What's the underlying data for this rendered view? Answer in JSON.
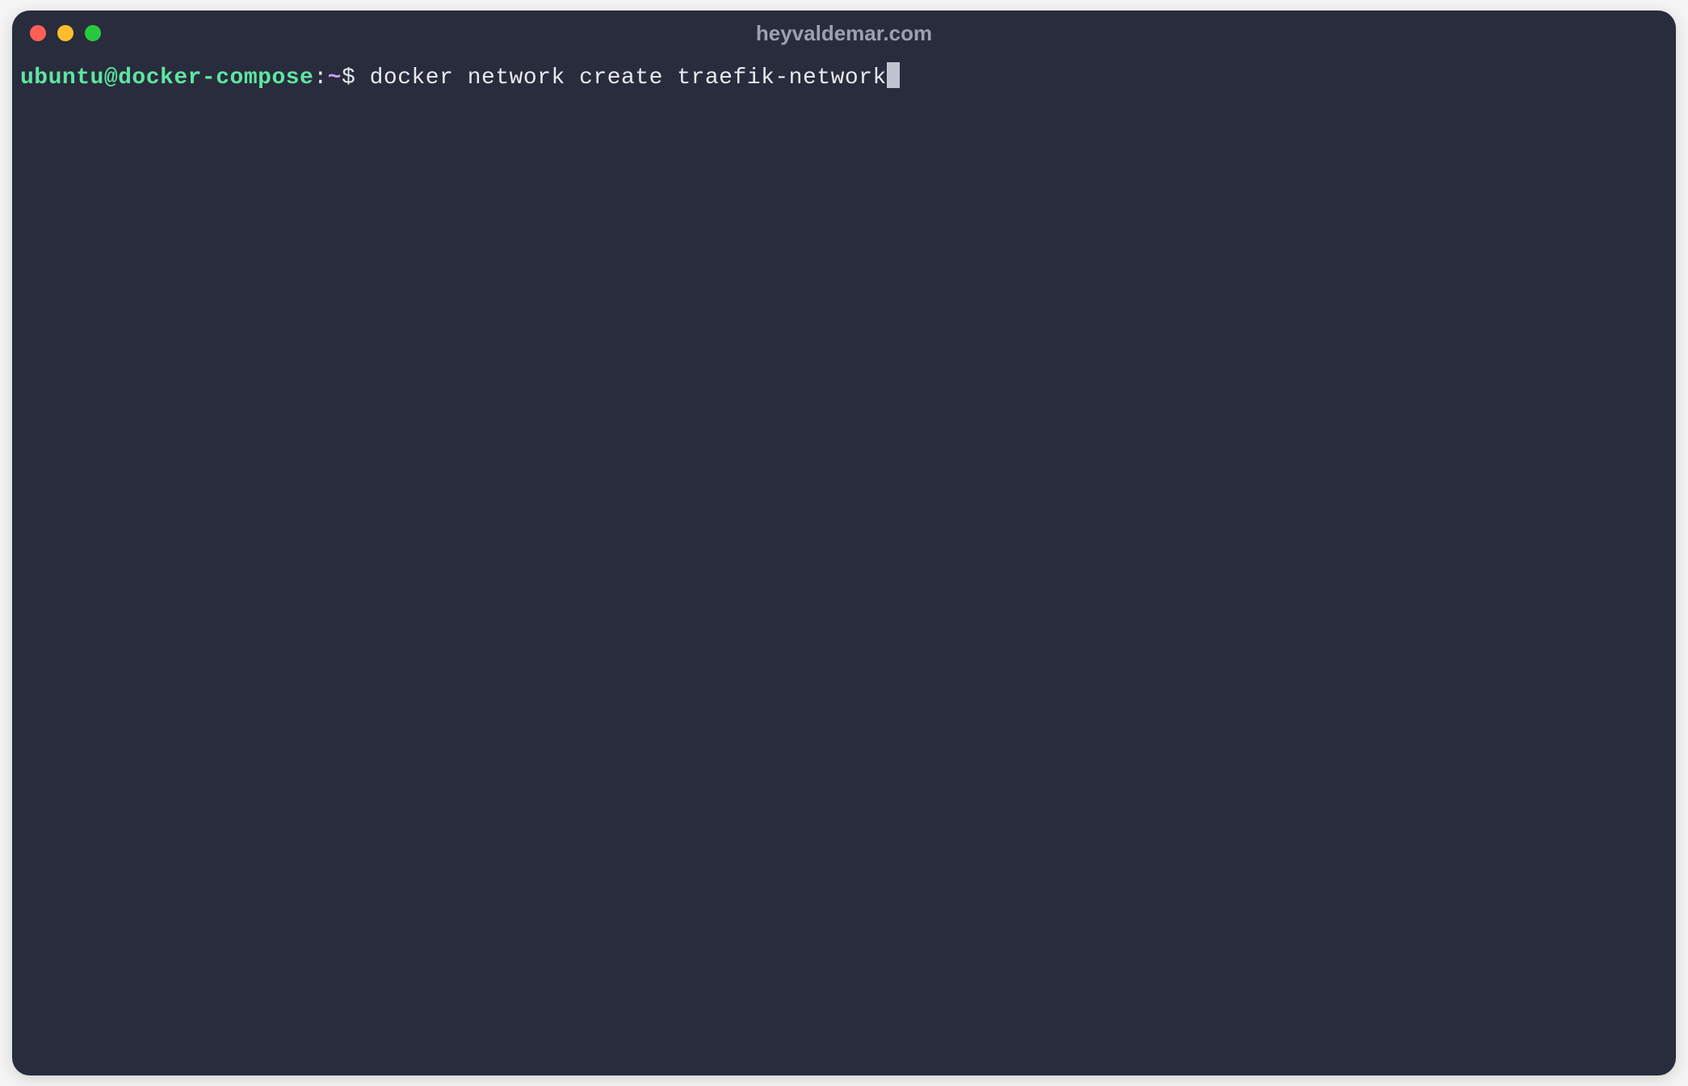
{
  "titleBar": {
    "title": "heyvaldemar.com"
  },
  "prompt": {
    "userHost": "ubuntu@docker-compose",
    "separator": ":",
    "path": "~",
    "symbol": "$",
    "command": " docker network create traefik-network"
  }
}
